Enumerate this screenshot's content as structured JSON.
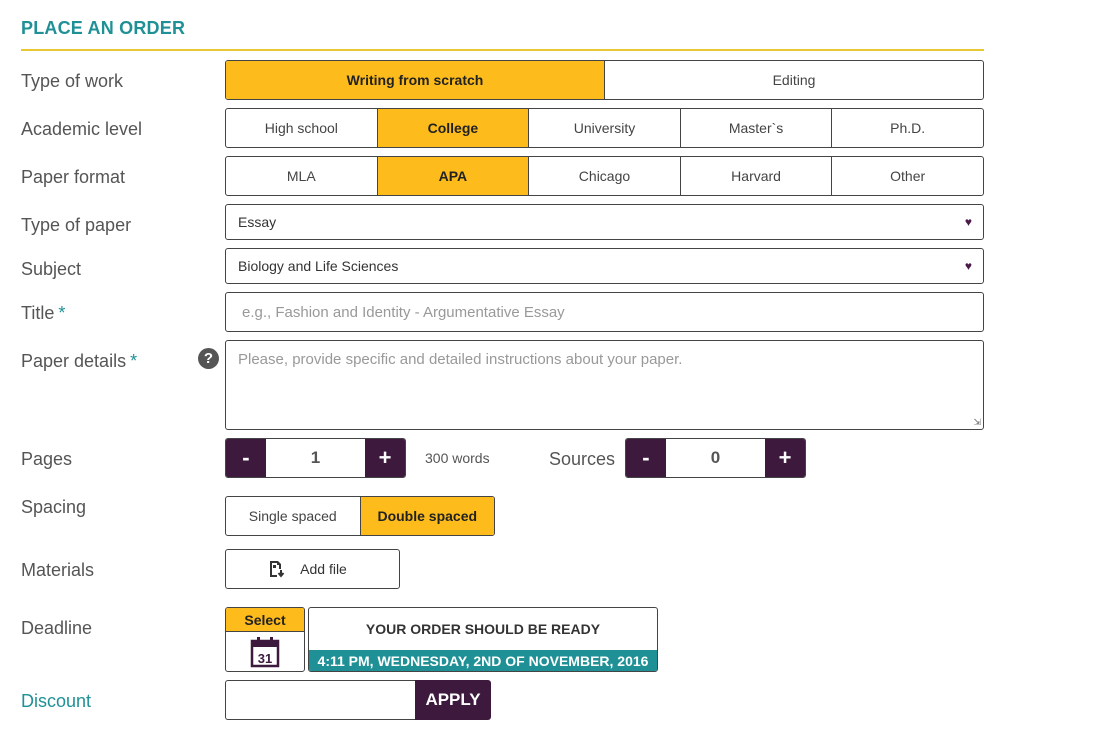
{
  "header": {
    "title": "PLACE AN ORDER"
  },
  "type_of_work": {
    "label": "Type of work",
    "options": [
      "Writing from scratch",
      "Editing"
    ],
    "selected": "Writing from scratch"
  },
  "academic_level": {
    "label": "Academic level",
    "options": [
      "High school",
      "College",
      "University",
      "Master`s",
      "Ph.D."
    ],
    "selected": "College"
  },
  "paper_format": {
    "label": "Paper format",
    "options": [
      "MLA",
      "APA",
      "Chicago",
      "Harvard",
      "Other"
    ],
    "selected": "APA"
  },
  "type_of_paper": {
    "label": "Type of paper",
    "value": "Essay"
  },
  "subject": {
    "label": "Subject",
    "value": "Biology and Life Sciences"
  },
  "title": {
    "label": "Title",
    "required_mark": "*",
    "placeholder": "e.g., Fashion and Identity - Argumentative Essay"
  },
  "paper_details": {
    "label": "Paper details",
    "required_mark": "*",
    "placeholder": "Please, provide specific and detailed instructions about your paper."
  },
  "pages": {
    "label": "Pages",
    "value": "1",
    "minus": "-",
    "plus": "+",
    "words": "300 words"
  },
  "sources": {
    "label": "Sources",
    "value": "0",
    "minus": "-",
    "plus": "+"
  },
  "spacing": {
    "label": "Spacing",
    "options": [
      "Single spaced",
      "Double spaced"
    ],
    "selected": "Double spaced"
  },
  "materials": {
    "label": "Materials",
    "button": "Add file"
  },
  "deadline": {
    "label": "Deadline",
    "select_label": "Select",
    "calendar_day": "31",
    "ready_title": "YOUR ORDER SHOULD BE READY",
    "ready_date": "4:11 PM, WEDNESDAY, 2ND OF NOVEMBER, 2016"
  },
  "discount": {
    "label": "Discount",
    "button": "APPLY"
  },
  "icons": {
    "caret": "heart-caret-icon",
    "help": "question-circle-icon",
    "file": "file-upload-icon",
    "calendar": "calendar-icon"
  },
  "colors": {
    "accent_yellow": "#fdbc1b",
    "teal": "#1f9196",
    "dark_purple": "#3d1a3d"
  }
}
